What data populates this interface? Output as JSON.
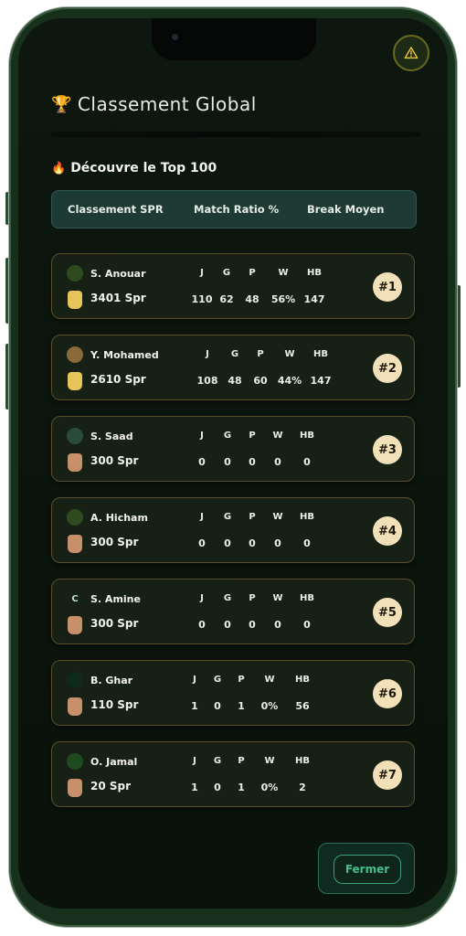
{
  "header": {
    "title": "Classement Global",
    "subtitle": "Découvre le Top 100",
    "warning_icon": "warning-icon",
    "trophy_icon": "trophy-icon",
    "fire_icon": "fire-icon"
  },
  "tabs": [
    {
      "label": "Classement SPR"
    },
    {
      "label": "Match Ratio %"
    },
    {
      "label": "Break Moyen"
    }
  ],
  "stat_headers": [
    "J",
    "G",
    "P",
    "W",
    "HB"
  ],
  "players": [
    {
      "name": "S. Anouar",
      "spr": "3401 Spr",
      "tier": "gold",
      "stats": [
        "110",
        "62",
        "48",
        "56%",
        "147"
      ],
      "rank": "#1"
    },
    {
      "name": "Y. Mohamed",
      "spr": "2610 Spr",
      "tier": "gold",
      "stats": [
        "108",
        "48",
        "60",
        "44%",
        "147"
      ],
      "rank": "#2"
    },
    {
      "name": "S. Saad",
      "spr": "300 Spr",
      "tier": "bronze",
      "stats": [
        "0",
        "0",
        "0",
        "0",
        "0"
      ],
      "rank": "#3"
    },
    {
      "name": "A. Hicham",
      "spr": "300 Spr",
      "tier": "bronze",
      "stats": [
        "0",
        "0",
        "0",
        "0",
        "0"
      ],
      "rank": "#4"
    },
    {
      "name": "S. Amine",
      "spr": "300 Spr",
      "tier": "bronze",
      "stats": [
        "0",
        "0",
        "0",
        "0",
        "0"
      ],
      "rank": "#5"
    },
    {
      "name": "B. Ghar",
      "spr": "110 Spr",
      "tier": "bronze",
      "stats": [
        "1",
        "0",
        "1",
        "0%",
        "56"
      ],
      "rank": "#6"
    },
    {
      "name": "O. Jamal",
      "spr": "20 Spr",
      "tier": "bronze",
      "stats": [
        "1",
        "0",
        "1",
        "0%",
        "2"
      ],
      "rank": "#7"
    }
  ],
  "footer": {
    "close_label": "Fermer"
  },
  "colors": {
    "gold_badge": "#e6c45a",
    "bronze_badge": "#c8906a",
    "rank_badge": "#f2e1b8",
    "accent_green": "#3fc08a"
  }
}
